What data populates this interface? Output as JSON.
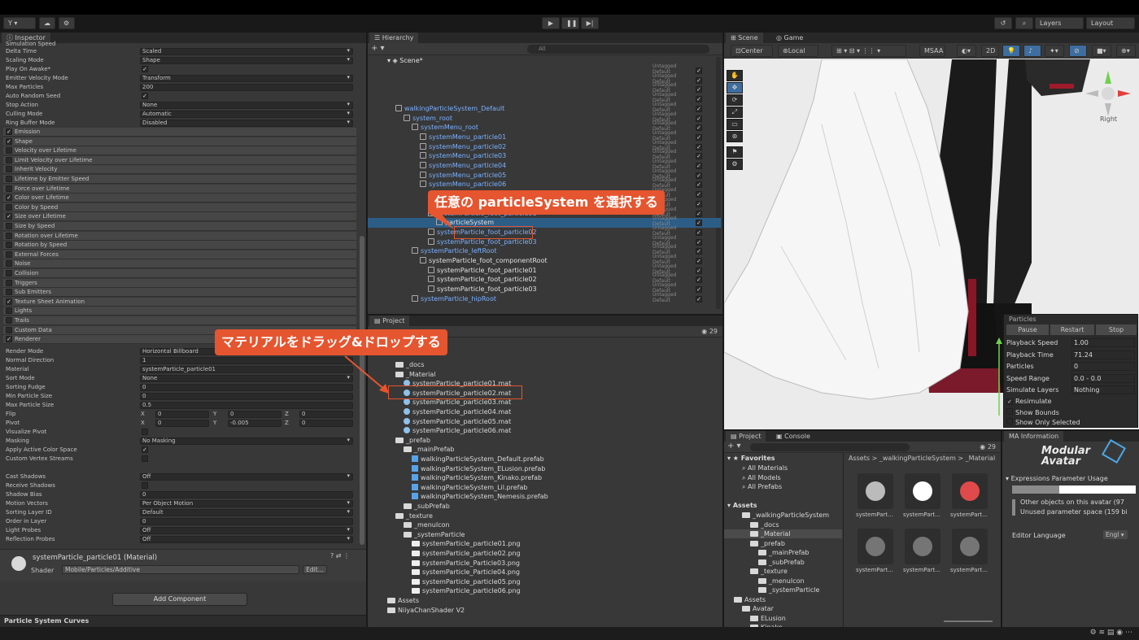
{
  "toolbar": {
    "account_label": "Y ▾",
    "layers_label": "Layers",
    "layout_label": "Layout"
  },
  "inspector": {
    "tab": "Inspector",
    "truncated_top": "Simulation Speed",
    "main_props": [
      {
        "label": "Delta Time",
        "value": "Scaled",
        "type": "dropdown"
      },
      {
        "label": "Scaling Mode",
        "value": "Shape",
        "type": "dropdown"
      },
      {
        "label": "Play On Awake*",
        "value": "✓",
        "type": "check"
      },
      {
        "label": "Emitter Velocity Mode",
        "value": "Transform",
        "type": "dropdown"
      },
      {
        "label": "Max Particles",
        "value": "200",
        "type": "field"
      },
      {
        "label": "Auto Random Seed",
        "value": "✓",
        "type": "check"
      },
      {
        "label": "Stop Action",
        "value": "None",
        "type": "dropdown"
      },
      {
        "label": "Culling Mode",
        "value": "Automatic",
        "type": "dropdown"
      },
      {
        "label": "Ring Buffer Mode",
        "value": "Disabled",
        "type": "dropdown"
      }
    ],
    "modules": [
      {
        "label": "Emission",
        "checked": "✓"
      },
      {
        "label": "Shape",
        "checked": "✓"
      },
      {
        "label": "Velocity over Lifetime",
        "checked": ""
      },
      {
        "label": "Limit Velocity over Lifetime",
        "checked": ""
      },
      {
        "label": "Inherit Velocity",
        "checked": ""
      },
      {
        "label": "Lifetime by Emitter Speed",
        "checked": ""
      },
      {
        "label": "Force over Lifetime",
        "checked": ""
      },
      {
        "label": "Color over Lifetime",
        "checked": "✓"
      },
      {
        "label": "Color by Speed",
        "checked": ""
      },
      {
        "label": "Size over Lifetime",
        "checked": "✓"
      },
      {
        "label": "Size by Speed",
        "checked": ""
      },
      {
        "label": "Rotation over Lifetime",
        "checked": ""
      },
      {
        "label": "Rotation by Speed",
        "checked": ""
      },
      {
        "label": "External Forces",
        "checked": ""
      },
      {
        "label": "Noise",
        "checked": ""
      },
      {
        "label": "Collision",
        "checked": ""
      },
      {
        "label": "Triggers",
        "checked": ""
      },
      {
        "label": "Sub Emitters",
        "checked": ""
      },
      {
        "label": "Texture Sheet Animation",
        "checked": "✓"
      },
      {
        "label": "Lights",
        "checked": ""
      },
      {
        "label": "Trails",
        "checked": ""
      },
      {
        "label": "Custom Data",
        "checked": ""
      },
      {
        "label": "Renderer",
        "checked": "✓"
      }
    ],
    "renderer_props": [
      {
        "label": "Render Mode",
        "value": "Horizontal Billboard",
        "type": "dropdown"
      },
      {
        "label": "Normal Direction",
        "value": "1",
        "type": "field"
      },
      {
        "label": "Material",
        "value": "systemParticle_particle01",
        "type": "object"
      },
      {
        "label": "Sort Mode",
        "value": "None",
        "type": "dropdown"
      },
      {
        "label": "Sorting Fudge",
        "value": "0",
        "type": "field"
      },
      {
        "label": "Min Particle Size",
        "value": "0",
        "type": "field"
      },
      {
        "label": "Max Particle Size",
        "value": "0.5",
        "type": "field"
      }
    ],
    "flip": {
      "label": "Flip",
      "x": "0",
      "y": "0",
      "z": "0"
    },
    "pivot": {
      "label": "Pivot",
      "x": "0",
      "y": "-0.005",
      "z": "0"
    },
    "axis_x": "X",
    "axis_y": "Y",
    "axis_z": "Z",
    "lower_props": [
      {
        "label": "Visualize Pivot",
        "value": "",
        "type": "check"
      },
      {
        "label": "Masking",
        "value": "No Masking",
        "type": "dropdown"
      },
      {
        "label": "Apply Active Color Space",
        "value": "✓",
        "type": "check"
      },
      {
        "label": "Custom Vertex Streams",
        "value": "",
        "type": "check"
      },
      {
        "label": "",
        "value": "",
        "type": "blank"
      },
      {
        "label": "Cast Shadows",
        "value": "Off",
        "type": "dropdown"
      },
      {
        "label": "Receive Shadows",
        "value": "",
        "type": "check"
      },
      {
        "label": "Shadow Bias",
        "value": "0",
        "type": "field"
      },
      {
        "label": "Motion Vectors",
        "value": "Per Object Motion",
        "type": "dropdown"
      },
      {
        "label": "Sorting Layer ID",
        "value": "Default",
        "type": "dropdown"
      },
      {
        "label": "Order in Layer",
        "value": "0",
        "type": "field"
      },
      {
        "label": "Light Probes",
        "value": "Off",
        "type": "dropdown"
      },
      {
        "label": "Reflection Probes",
        "value": "Off",
        "type": "dropdown"
      }
    ],
    "material_header": "systemParticle_particle01 (Material)",
    "shader_label": "Shader",
    "shader_value": "Mobile/Particles/Additive",
    "edit_label": "Edit...",
    "add_component": "Add Component",
    "curves_label": "Particle System Curves"
  },
  "hierarchy": {
    "tab": "Hierarchy",
    "search_placeholder": "All",
    "scene": "Scene*",
    "tag": "Untagged",
    "layer": "Default",
    "rows": [
      {
        "indent": 0,
        "label": "",
        "color": "white"
      },
      {
        "indent": 0,
        "label": "",
        "color": "white"
      },
      {
        "indent": 0,
        "label": "",
        "color": "white"
      },
      {
        "indent": 0,
        "label": "",
        "color": "white"
      },
      {
        "indent": 1,
        "label": "walkingParticleSystem_Default",
        "color": "blue"
      },
      {
        "indent": 2,
        "label": "system_root",
        "color": "blue"
      },
      {
        "indent": 3,
        "label": "systemMenu_root",
        "color": "blue"
      },
      {
        "indent": 4,
        "label": "systemMenu_particle01",
        "color": "blue"
      },
      {
        "indent": 4,
        "label": "systemMenu_particle02",
        "color": "blue"
      },
      {
        "indent": 4,
        "label": "systemMenu_particle03",
        "color": "blue"
      },
      {
        "indent": 4,
        "label": "systemMenu_particle04",
        "color": "blue"
      },
      {
        "indent": 4,
        "label": "systemMenu_particle05",
        "color": "blue"
      },
      {
        "indent": 4,
        "label": "systemMenu_particle06",
        "color": "blue"
      },
      {
        "indent": 3,
        "label": "",
        "color": "blue"
      },
      {
        "indent": 4,
        "label": "",
        "color": "blue"
      },
      {
        "indent": 5,
        "label": "systemParticle_foot_particle01",
        "color": "blue"
      },
      {
        "indent": 6,
        "label": "particleSystem",
        "color": "white"
      },
      {
        "indent": 5,
        "label": "systemParticle_foot_particle02",
        "color": "blue"
      },
      {
        "indent": 5,
        "label": "systemParticle_foot_particle03",
        "color": "blue"
      },
      {
        "indent": 3,
        "label": "systemParticle_leftRoot",
        "color": "blue"
      },
      {
        "indent": 4,
        "label": "systemParticle_foot_componentRoot",
        "color": "white"
      },
      {
        "indent": 5,
        "label": "systemParticle_foot_particle01",
        "color": "white"
      },
      {
        "indent": 5,
        "label": "systemParticle_foot_particle02",
        "color": "white"
      },
      {
        "indent": 5,
        "label": "systemParticle_foot_particle03",
        "color": "white"
      },
      {
        "indent": 3,
        "label": "systemParticle_hipRoot",
        "color": "blue"
      }
    ]
  },
  "project": {
    "tab": "Project",
    "count": "29",
    "rows": [
      {
        "indent": 1,
        "icon": "folder",
        "label": "_docs"
      },
      {
        "indent": 1,
        "icon": "folder",
        "label": "_Material"
      },
      {
        "indent": 2,
        "icon": "mat",
        "label": "systemParticle_particle01.mat"
      },
      {
        "indent": 2,
        "icon": "mat",
        "label": "systemParticle_particle02.mat"
      },
      {
        "indent": 2,
        "icon": "mat",
        "label": "systemParticle_particle03.mat"
      },
      {
        "indent": 2,
        "icon": "mat",
        "label": "systemParticle_particle04.mat"
      },
      {
        "indent": 2,
        "icon": "mat",
        "label": "systemParticle_particle05.mat"
      },
      {
        "indent": 2,
        "icon": "mat",
        "label": "systemParticle_particle06.mat"
      },
      {
        "indent": 1,
        "icon": "folder",
        "label": "_prefab"
      },
      {
        "indent": 2,
        "icon": "folder",
        "label": "_mainPrefab"
      },
      {
        "indent": 3,
        "icon": "prefab",
        "label": "walkingParticleSystem_Default.prefab"
      },
      {
        "indent": 3,
        "icon": "prefab",
        "label": "walkingParticleSystem_ELusion.prefab"
      },
      {
        "indent": 3,
        "icon": "prefab",
        "label": "walkingParticleSystem_Kinako.prefab"
      },
      {
        "indent": 3,
        "icon": "prefab",
        "label": "walkingParticleSystem_Lil.prefab"
      },
      {
        "indent": 3,
        "icon": "prefab",
        "label": "walkingParticleSystem_Nemesis.prefab"
      },
      {
        "indent": 2,
        "icon": "folder",
        "label": "_subPrefab"
      },
      {
        "indent": 1,
        "icon": "folder",
        "label": "_texture"
      },
      {
        "indent": 2,
        "icon": "folder",
        "label": "_menuIcon"
      },
      {
        "indent": 2,
        "icon": "folder",
        "label": "_systemParticle"
      },
      {
        "indent": 3,
        "icon": "png",
        "label": "systemParticle_particle01.png"
      },
      {
        "indent": 3,
        "icon": "png",
        "label": "systemParticle_particle02.png"
      },
      {
        "indent": 3,
        "icon": "png",
        "label": "systemParticle_Particle03.png"
      },
      {
        "indent": 3,
        "icon": "png",
        "label": "systemParticle_Particle04.png"
      },
      {
        "indent": 3,
        "icon": "png",
        "label": "systemParticle_particle05.png"
      },
      {
        "indent": 3,
        "icon": "png",
        "label": "systemParticle_particle06.png"
      },
      {
        "indent": 0,
        "icon": "folder",
        "label": "Assets"
      },
      {
        "indent": 0,
        "icon": "folder",
        "label": "NiiyaChanShader V2"
      }
    ]
  },
  "scene": {
    "tab_scene": "Scene",
    "tab_game": "Game",
    "center": "Center",
    "local": "Local",
    "msaa": "MSAA",
    "mode_2d": "2D",
    "right_label": "Right"
  },
  "particles_overlay": {
    "title": "Particles",
    "pause": "Pause",
    "restart": "Restart",
    "stop": "Stop",
    "rows": [
      {
        "label": "Playback Speed",
        "value": "1.00"
      },
      {
        "label": "Playback Time",
        "value": "71.24"
      },
      {
        "label": "Particles",
        "value": "0"
      },
      {
        "label": "Speed Range",
        "value": "0.0 - 0.0"
      },
      {
        "label": "Simulate Layers",
        "value": "Nothing"
      }
    ],
    "resimulate": "Resimulate",
    "show_bounds": "Show Bounds",
    "show_only_selected": "Show Only Selected"
  },
  "project2": {
    "tab_project": "Project",
    "tab_console": "Console",
    "count": "29",
    "favorites": "Favorites",
    "fav_items": [
      "All Materials",
      "All Models",
      "All Prefabs"
    ],
    "assets": "Assets",
    "tree": [
      {
        "indent": 1,
        "label": "_walkingParticleSystem"
      },
      {
        "indent": 2,
        "label": "_docs"
      },
      {
        "indent": 2,
        "label": "_Material"
      },
      {
        "indent": 2,
        "label": "_prefab"
      },
      {
        "indent": 3,
        "label": "_mainPrefab"
      },
      {
        "indent": 3,
        "label": "_subPrefab"
      },
      {
        "indent": 2,
        "label": "_texture"
      },
      {
        "indent": 3,
        "label": "_menuIcon"
      },
      {
        "indent": 3,
        "label": "_systemParticle"
      },
      {
        "indent": 0,
        "label": "Assets"
      },
      {
        "indent": 1,
        "label": "Avatar"
      },
      {
        "indent": 2,
        "label": "ELusion"
      },
      {
        "indent": 2,
        "label": "Kinako"
      }
    ],
    "breadcrumb": "Assets > _walkingParticleSystem > _Material",
    "thumb_label": "systemPart..."
  },
  "ma": {
    "tab": "MA Information",
    "logo_line1": "Modular",
    "logo_line2": "Avatar",
    "section": "Expressions Parameter Usage",
    "line1": "Other objects on this avatar (97",
    "line2": "Unused parameter space (159 bi",
    "editor_language": "Editor Language",
    "language_value": "Engl"
  },
  "callouts": {
    "select": "任意の particleSystem を選択する",
    "drag": "マテリアルをドラッグ&ドロップする"
  },
  "colors": {
    "accent": "#e5552f",
    "selection": "#2c5d87",
    "link_blue": "#7ab1ff"
  }
}
